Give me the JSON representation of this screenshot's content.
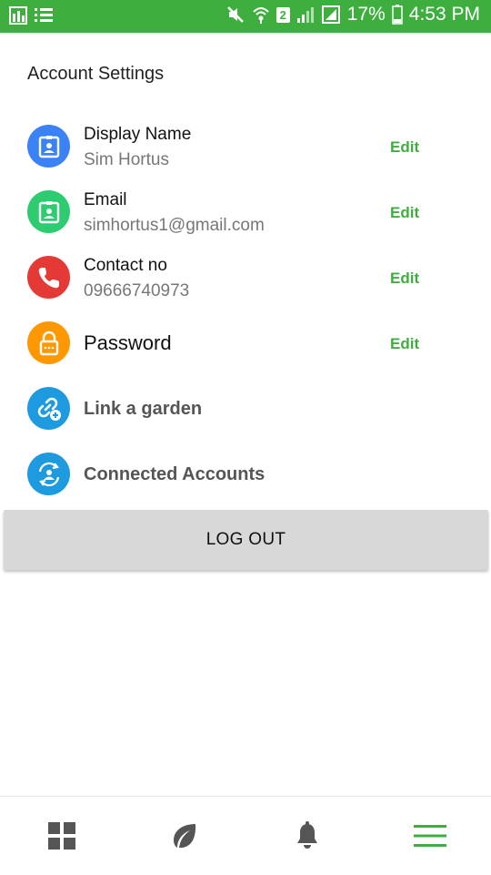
{
  "status_bar": {
    "battery_percent": "17%",
    "time": "4:53 PM",
    "sim_badge": "2",
    "icons": [
      "app-icon",
      "list-icon",
      "mute-icon",
      "wifi-icon",
      "signal-icon",
      "screenshot-icon",
      "battery-icon"
    ]
  },
  "page": {
    "title": "Account Settings"
  },
  "settings": [
    {
      "label": "Display Name",
      "value": "Sim Hortus",
      "action": "Edit",
      "icon": "contact-card-icon",
      "color": "#3b82f6"
    },
    {
      "label": "Email",
      "value": "simhortus1@gmail.com",
      "action": "Edit",
      "icon": "contact-card-icon",
      "color": "#2ecc71"
    },
    {
      "label": "Contact no",
      "value": "09666740973",
      "action": "Edit",
      "icon": "phone-icon",
      "color": "#e53935"
    },
    {
      "label": "Password",
      "action": "Edit",
      "icon": "lock-icon",
      "color": "#ff9800"
    },
    {
      "label": "Link a garden",
      "icon": "link-add-icon",
      "color": "#1e9be0"
    },
    {
      "label": "Connected Accounts",
      "icon": "connected-accounts-icon",
      "color": "#1e9be0"
    }
  ],
  "logout": {
    "label": "LOG OUT"
  },
  "bottom_nav": {
    "items": [
      "dashboard-icon",
      "leaf-icon",
      "bell-icon",
      "menu-icon"
    ],
    "active_color": "#3eaf3f",
    "inactive_color": "#555555"
  }
}
